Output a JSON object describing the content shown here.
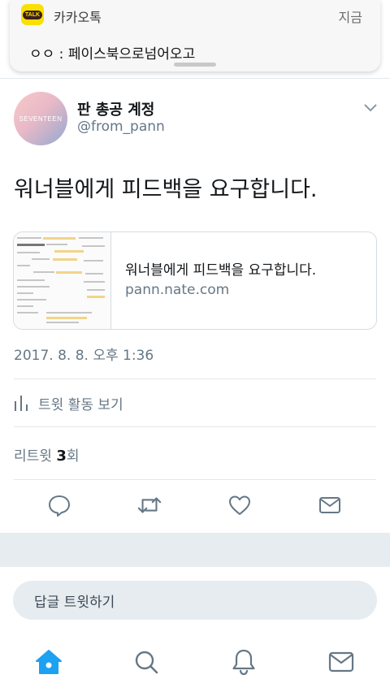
{
  "notification": {
    "app_icon_text": "TALK",
    "app_name": "카카오톡",
    "time": "지금",
    "message": "ㅇㅇ : 페이스북으로넘어오고"
  },
  "tweet": {
    "avatar_text": "SEVENTEEN",
    "display_name": "판 총공 계정",
    "handle": "@from_pann",
    "text": "워너블에게 피드백을 요구합니다.",
    "card": {
      "title": "워너블에게 피드백을 요구합니다.",
      "domain": "pann.nate.com"
    },
    "timestamp": "2017. 8. 8. 오후 1:36",
    "activity_label": "트윗 활동 보기",
    "retweet_label": "리트윗",
    "retweet_count": "3",
    "retweet_suffix": "회"
  },
  "reply": {
    "placeholder": "답글 트윗하기"
  },
  "actions": [
    "reply-icon",
    "retweet-icon",
    "like-icon",
    "dm-icon"
  ],
  "nav": [
    "home-icon",
    "search-icon",
    "notifications-icon",
    "messages-icon"
  ],
  "colors": {
    "accent": "#1da1f2",
    "icon_gray": "#657786",
    "kakao_yellow": "#f9e000"
  }
}
